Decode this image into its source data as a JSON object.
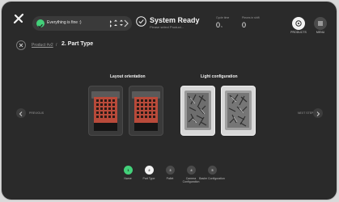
{
  "status": {
    "text": "Everything is fine :)"
  },
  "system": {
    "title": "System Ready",
    "subtitle": "Please select Product..."
  },
  "metrics": [
    {
      "label": "Cycle time",
      "value": "0",
      "unit": "s"
    },
    {
      "label": "Pieces in shift",
      "value": "0",
      "unit": ""
    }
  ],
  "nav": {
    "products_label": "PRODUCTS",
    "menu_label": "MENU"
  },
  "header": {
    "breadcrumb": "Product #v2",
    "separator": "/",
    "title": "2. Part Type"
  },
  "sections": {
    "layout": "Layout orientation",
    "light": "Light configuration"
  },
  "navigation": {
    "previous": "PREVIOUS",
    "next": "NEXT STEP"
  },
  "steps": [
    {
      "number": "1",
      "label": "Name",
      "state": "done"
    },
    {
      "number": "2",
      "label": "Part Type",
      "state": "active"
    },
    {
      "number": "3",
      "label": "Pallet",
      "state": "pending"
    },
    {
      "number": "4",
      "label": "Camera Configuration",
      "state": "pending"
    },
    {
      "number": "5",
      "label": "Basler Configuration",
      "state": "pending"
    }
  ],
  "colors": {
    "accent_green": "#43d17a",
    "background": "#2a2a2a"
  }
}
